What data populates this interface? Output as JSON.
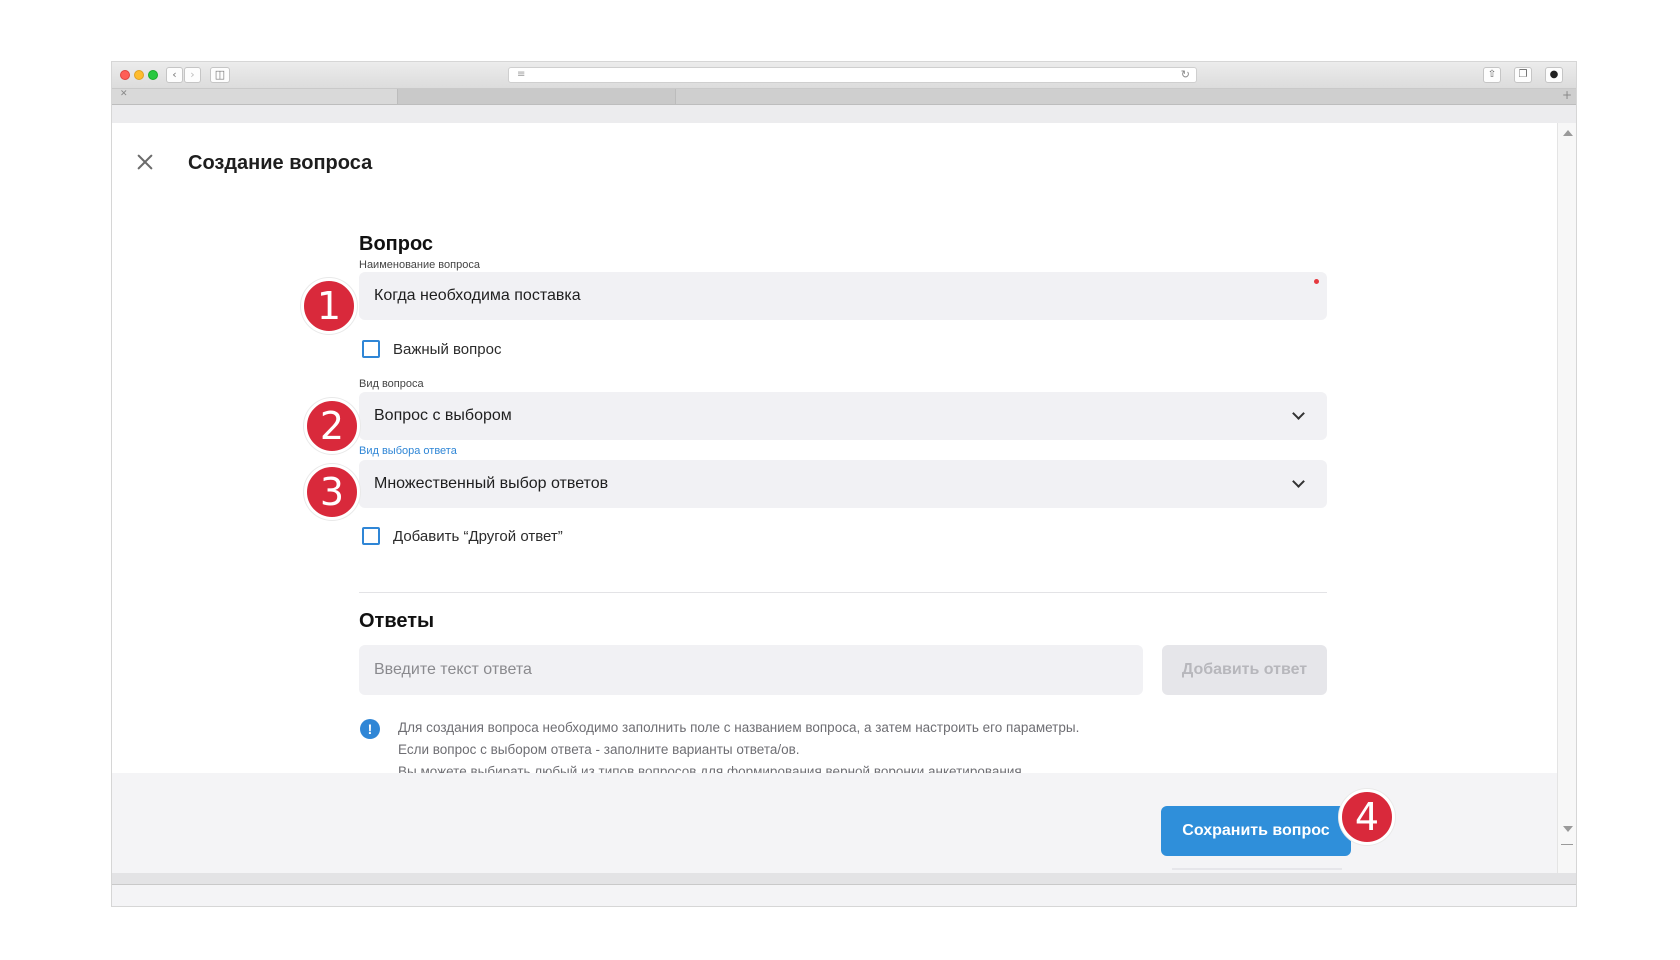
{
  "page": {
    "title": "Создание вопроса",
    "close_icon": "close-icon"
  },
  "question_section": {
    "title": "Вопрос",
    "name_label": "Наименование вопроса",
    "name_value": "Когда необходима поставка",
    "important_label": "Важный вопрос",
    "type_label": "Вид вопроса",
    "type_value": "Вопрос с выбором",
    "choice_label": "Вид выбора ответа",
    "choice_value": "Множественный выбор ответов",
    "other_answer_label": "Добавить “Другой ответ”"
  },
  "answers_section": {
    "title": "Ответы",
    "input_placeholder": "Введите текст ответа",
    "add_button": "Добавить ответ"
  },
  "info": {
    "icon": "!",
    "lines": [
      "Для создания вопроса необходимо заполнить поле с названием вопроса, а затем настроить его параметры.",
      "Если вопрос с выбором ответа - заполните варианты ответа/ов.",
      "Вы можете выбирать любый из типов вопросов для формирования верной воронки анкетирования."
    ]
  },
  "footer": {
    "save_button": "Сохранить вопрос"
  },
  "annotations": [
    "1",
    "2",
    "3",
    "4"
  ],
  "colors": {
    "accent": "#2f8fda",
    "badge": "#d9293b",
    "required": "#e5393f",
    "field_bg": "#f1f1f4"
  }
}
